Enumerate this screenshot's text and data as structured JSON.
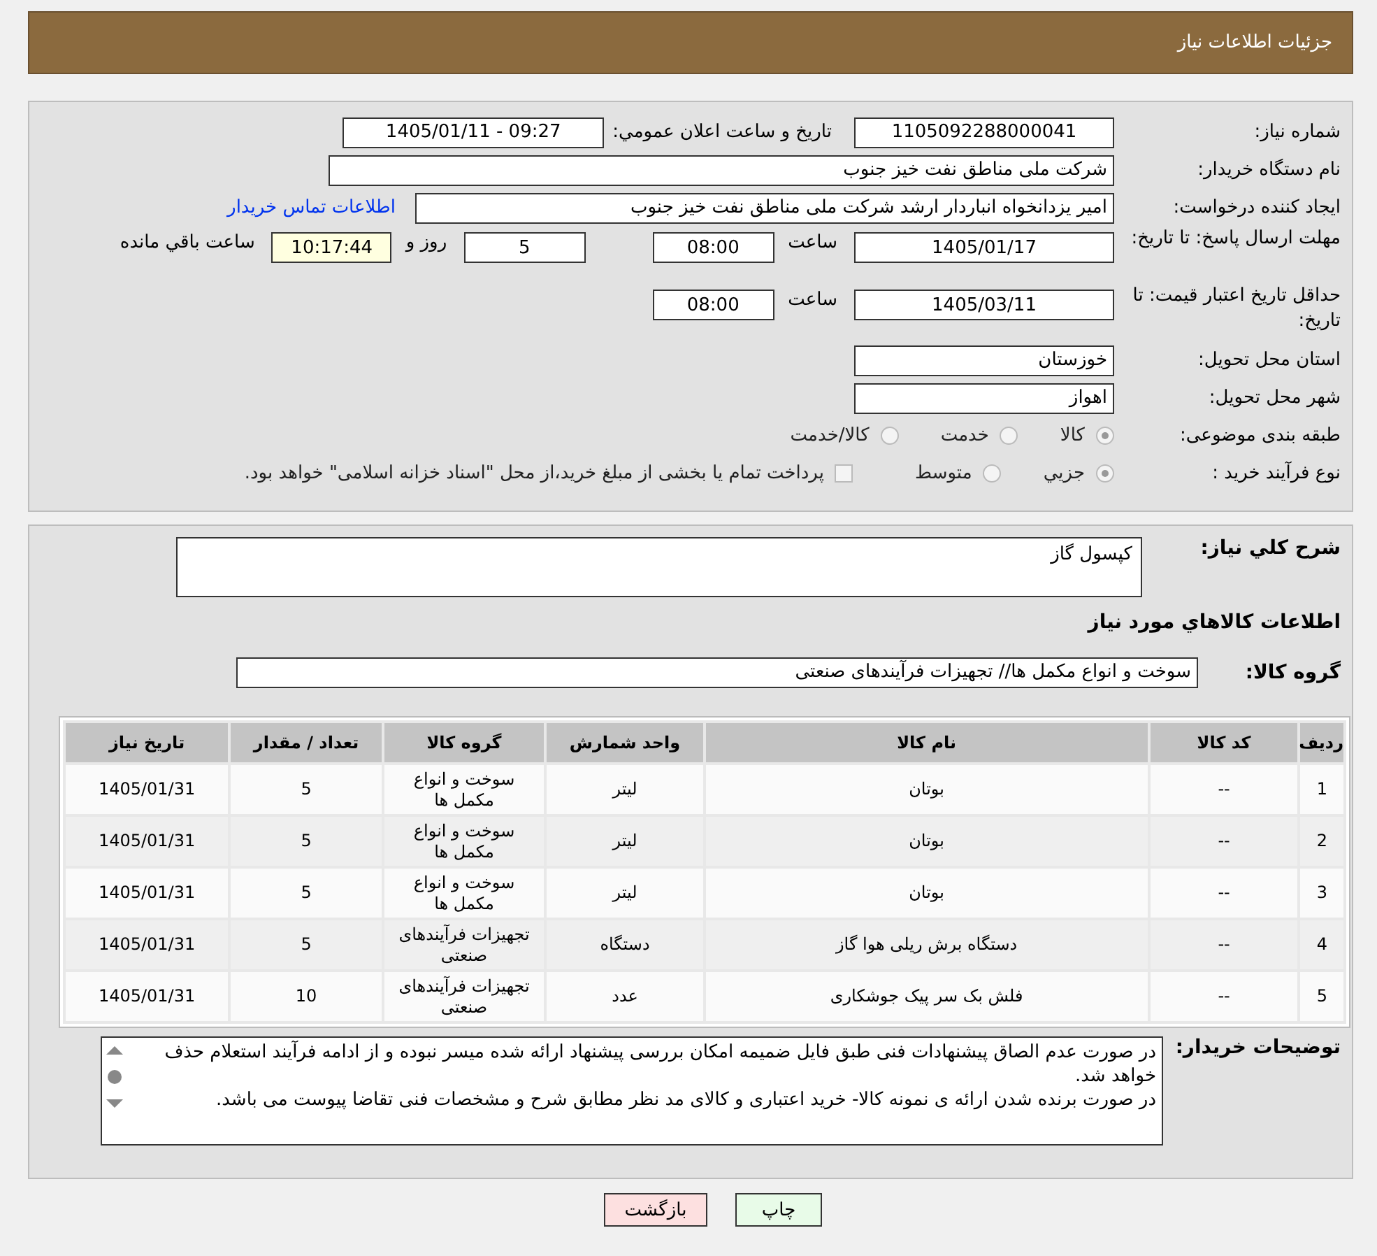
{
  "header": {
    "title": "جزئیات اطلاعات نیاز"
  },
  "info": {
    "need_number": {
      "label": "شماره نیاز:",
      "value": "1105092288000041"
    },
    "announce": {
      "label": "تاریخ و ساعت اعلان عمومي:",
      "value": "1405/01/11 - 09:27"
    },
    "buyer": {
      "label": "نام دستگاه خریدار:",
      "value": "شرکت ملی مناطق نفت خیز جنوب"
    },
    "requester": {
      "label": "ایجاد کننده درخواست:",
      "value": "امیر یزدانخواه انباردار ارشد شرکت ملی مناطق نفت خیز جنوب",
      "link": "اطلاعات تماس خریدار"
    },
    "deadline": {
      "label": "مهلت ارسال پاسخ: تا تاریخ:",
      "date": "1405/01/17",
      "time_label": "ساعت",
      "time": "08:00",
      "days": "5",
      "days_label": "روز و",
      "remaining": "10:17:44",
      "remaining_label": "ساعت باقي مانده"
    },
    "validity": {
      "label": "حداقل تاریخ اعتبار قیمت: تا تاریخ:",
      "date": "1405/03/11",
      "time_label": "ساعت",
      "time": "08:00"
    },
    "province": {
      "label": "استان محل تحویل:",
      "value": "خوزستان"
    },
    "city": {
      "label": "شهر محل تحویل:",
      "value": "اهواز"
    },
    "category": {
      "label": "طبقه بندی موضوعی:",
      "options": [
        {
          "label": "کالا",
          "selected": true
        },
        {
          "label": "خدمت",
          "selected": false
        },
        {
          "label": "کالا/خدمت",
          "selected": false
        }
      ]
    },
    "process": {
      "label": "نوع فرآیند خرید :",
      "options": [
        {
          "label": "جزيي",
          "selected": true
        },
        {
          "label": "متوسط",
          "selected": false
        }
      ],
      "payment": {
        "label": "پرداخت تمام یا بخشی از مبلغ خرید،از محل \"اسناد خزانه اسلامی\" خواهد بود.",
        "checked": false
      }
    }
  },
  "description": {
    "label": "شرح کلي نیاز:",
    "value": "کپسول گاز"
  },
  "goods_title": "اطلاعات کالاهاي مورد نیاز",
  "goods_group": {
    "label": "گروه کالا:",
    "value": "سوخت و انواع مکمل ها// تجهیزات فرآیندهای صنعتی"
  },
  "table": {
    "columns": [
      "ردیف",
      "کد کالا",
      "نام کالا",
      "واحد شمارش",
      "گروه کالا",
      "تعداد / مقدار",
      "تاریخ نیاز"
    ],
    "rows": [
      [
        "1",
        "--",
        "بوتان",
        "لیتر",
        "سوخت و انواع مکمل ها",
        "5",
        "1405/01/31"
      ],
      [
        "2",
        "--",
        "بوتان",
        "لیتر",
        "سوخت و انواع مکمل ها",
        "5",
        "1405/01/31"
      ],
      [
        "3",
        "--",
        "بوتان",
        "لیتر",
        "سوخت و انواع مکمل ها",
        "5",
        "1405/01/31"
      ],
      [
        "4",
        "--",
        "دستگاه برش ریلی هوا گاز",
        "دستگاه",
        "تجهیزات فرآیندهای صنعتی",
        "5",
        "1405/01/31"
      ],
      [
        "5",
        "--",
        "فلش بک سر پیک جوشکاری",
        "عدد",
        "تجهیزات فرآیندهای صنعتی",
        "10",
        "1405/01/31"
      ]
    ]
  },
  "buyer_notes": {
    "label": "توضیحات خریدار:",
    "paragraphs": [
      "در صورت عدم الصاق پیشنهادات فنی طبق فایل ضمیمه امکان بررسی پیشنهاد ارائه شده میسر نبوده و از ادامه فرآیند استعلام حذف خواهد شد.",
      "در صورت برنده شدن ارائه ی نمونه کالا- خرید اعتباری و کالای مد نظر مطابق شرح و مشخصات فنی تقاضا پیوست می باشد."
    ]
  },
  "buttons": [
    {
      "label": "چاپ",
      "kind": "print"
    },
    {
      "label": "بازگشت",
      "kind": "back"
    }
  ]
}
